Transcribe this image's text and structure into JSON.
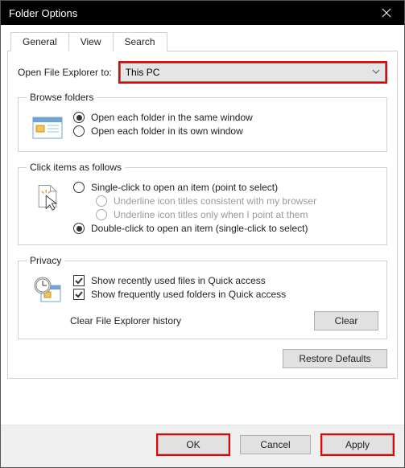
{
  "window": {
    "title": "Folder Options"
  },
  "tabs": {
    "general": "General",
    "view": "View",
    "search": "Search"
  },
  "open_to": {
    "label": "Open File Explorer to:",
    "value": "This PC"
  },
  "browse": {
    "legend": "Browse folders",
    "same": "Open each folder in the same window",
    "own": "Open each folder in its own window"
  },
  "click": {
    "legend": "Click items as follows",
    "single": "Single-click to open an item (point to select)",
    "under_browser": "Underline icon titles consistent with my browser",
    "under_point": "Underline icon titles only when I point at them",
    "double": "Double-click to open an item (single-click to select)"
  },
  "privacy": {
    "legend": "Privacy",
    "recent": "Show recently used files in Quick access",
    "frequent": "Show frequently used folders in Quick access",
    "clear_label": "Clear File Explorer history",
    "clear_button": "Clear"
  },
  "restore": "Restore Defaults",
  "buttons": {
    "ok": "OK",
    "cancel": "Cancel",
    "apply": "Apply"
  }
}
